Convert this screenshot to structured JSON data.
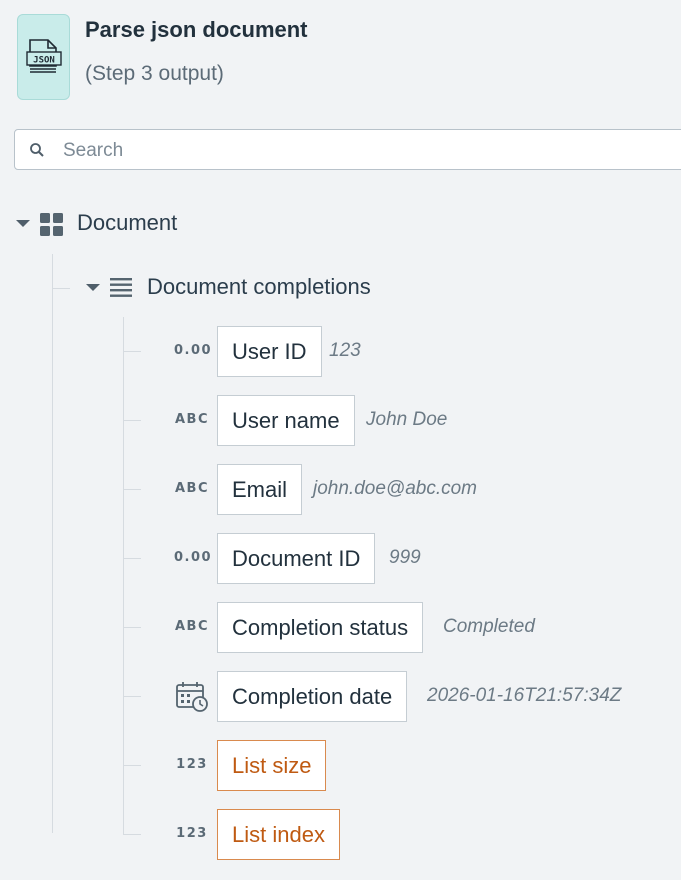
{
  "header": {
    "icon_text": "JSON",
    "title": "Parse json document",
    "subtitle": "(Step 3 output)"
  },
  "search": {
    "placeholder": "Search",
    "value": ""
  },
  "tree": {
    "root": {
      "label": "Document",
      "icon": "grid-icon",
      "expanded": true
    },
    "child": {
      "label": "Document completions",
      "icon": "list-icon",
      "expanded": true
    },
    "fields": [
      {
        "type_badge": "0.00",
        "label": "User ID",
        "sample": "123"
      },
      {
        "type_badge": "ABC",
        "label": "User name",
        "sample": "John Doe"
      },
      {
        "type_badge": "ABC",
        "label": "Email",
        "sample": "john.doe@abc.com"
      },
      {
        "type_badge": "0.00",
        "label": "Document ID",
        "sample": "999"
      },
      {
        "type_badge": "ABC",
        "label": "Completion status",
        "sample": "Completed"
      },
      {
        "type_icon": "calendar-clock-icon",
        "label": "Completion date",
        "sample": "2026-01-16T21:57:34Z"
      },
      {
        "type_badge": "123",
        "label": "List size",
        "meta": true
      },
      {
        "type_badge": "123",
        "label": "List index",
        "meta": true
      }
    ]
  },
  "colors": {
    "icon_bg": "#c9ecea",
    "meta_accent": "#bf5a12",
    "text": "#2b3d4c"
  }
}
